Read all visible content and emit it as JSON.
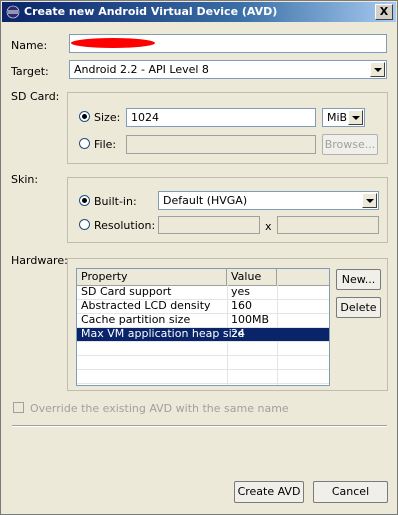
{
  "window": {
    "title": "Create new Android Virtual Device (AVD)",
    "close_label": "X"
  },
  "name": {
    "label": "Name:",
    "value": ""
  },
  "target": {
    "label": "Target:",
    "value": "Android 2.2 - API Level 8"
  },
  "sdcard": {
    "label": "SD Card:",
    "size_label": "Size:",
    "size_value": "1024",
    "unit": "MiB",
    "file_label": "File:",
    "file_value": "",
    "browse_label": "Browse..."
  },
  "skin": {
    "label": "Skin:",
    "builtin_label": "Built-in:",
    "builtin_value": "Default (HVGA)",
    "resolution_label": "Resolution:",
    "resolution_x": "x"
  },
  "hardware": {
    "label": "Hardware:",
    "columns": [
      "Property",
      "Value"
    ],
    "rows": [
      {
        "property": "SD Card support",
        "value": "yes"
      },
      {
        "property": "Abstracted LCD density",
        "value": "160"
      },
      {
        "property": "Cache partition size",
        "value": "100MB"
      },
      {
        "property": "Max VM application heap size",
        "value": "24"
      }
    ],
    "new_label": "New...",
    "delete_label": "Delete"
  },
  "override": {
    "label": "Override the existing AVD with the same name"
  },
  "buttons": {
    "create_label": "Create AVD",
    "cancel_label": "Cancel"
  },
  "colors": {
    "selection": "#0a246a",
    "redacted": "#ff0000",
    "title_bar": "#0a246a"
  }
}
